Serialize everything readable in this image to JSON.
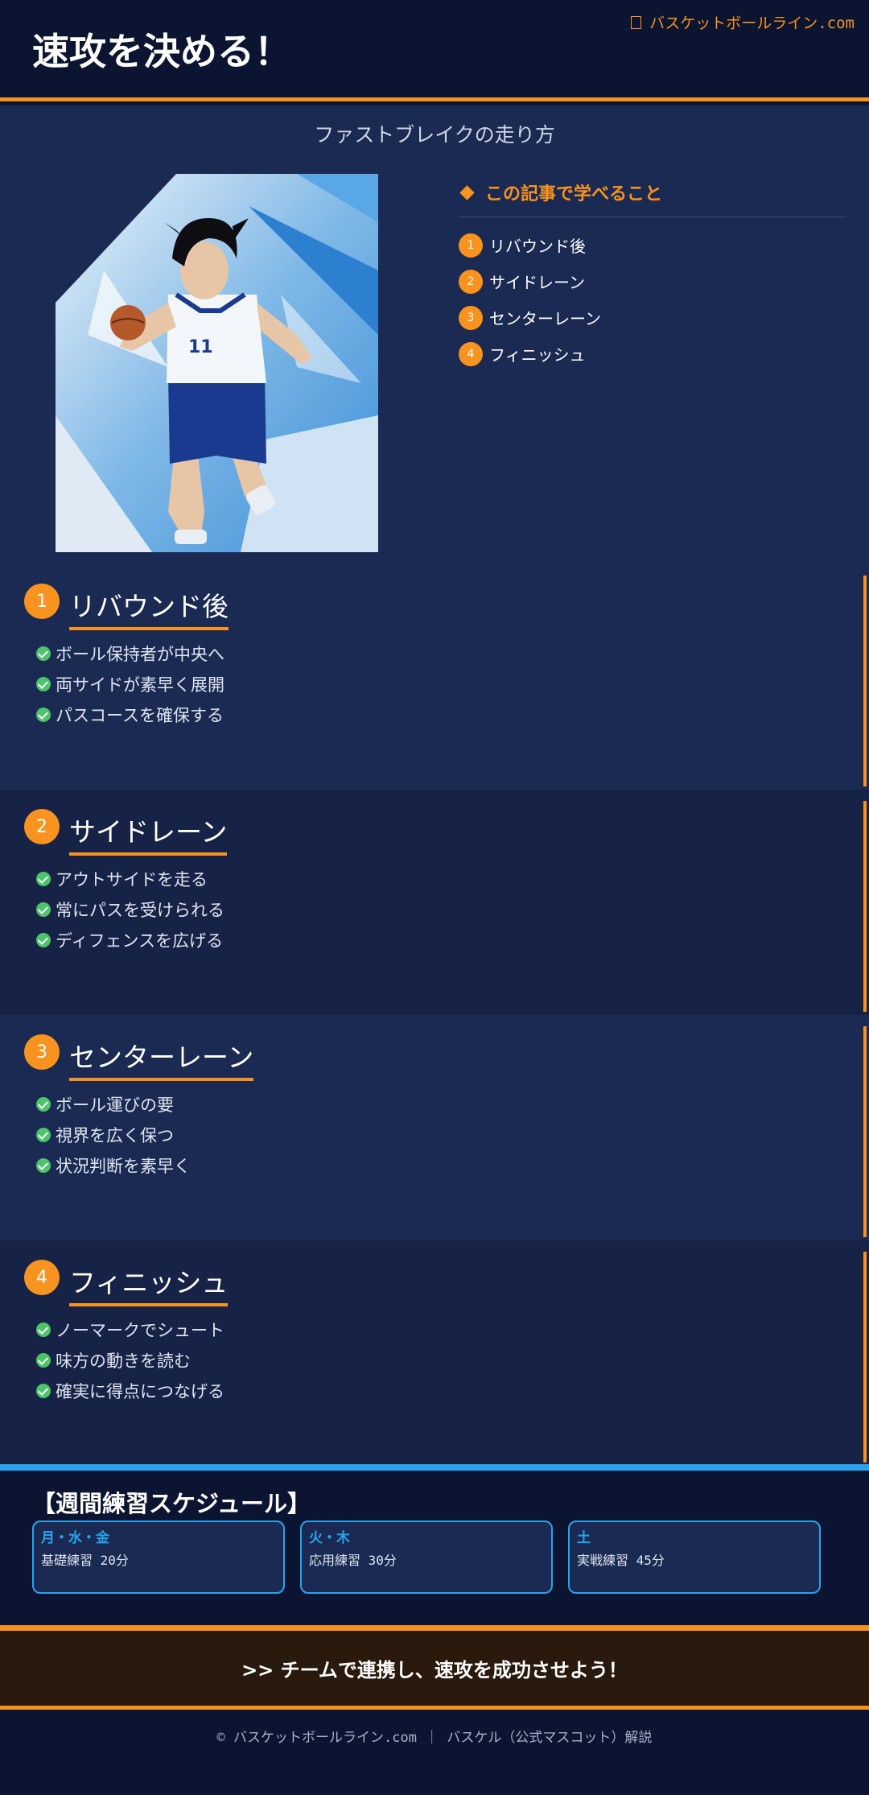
{
  "header": {
    "title": "速攻を決める！",
    "site": "バスケットボールライン.com"
  },
  "subtitle": "ファストブレイクの走り方",
  "toc": {
    "heading": "この記事で学べること",
    "items": [
      {
        "num": "1",
        "label": "リバウンド後"
      },
      {
        "num": "2",
        "label": "サイドレーン"
      },
      {
        "num": "3",
        "label": "センターレーン"
      },
      {
        "num": "4",
        "label": "フィニッシュ"
      }
    ]
  },
  "sections": [
    {
      "num": "1",
      "title": "リバウンド後",
      "bullets": [
        "ボール保持者が中央へ",
        "両サイドが素早く展開",
        "パスコースを確保する"
      ],
      "bg": "#1b2a52"
    },
    {
      "num": "2",
      "title": "サイドレーン",
      "bullets": [
        "アウトサイドを走る",
        "常にパスを受けられる",
        "ディフェンスを広げる"
      ],
      "bg": "#172346"
    },
    {
      "num": "3",
      "title": "センターレーン",
      "bullets": [
        "ボール運びの要",
        "視界を広く保つ",
        "状況判断を素早く"
      ],
      "bg": "#1b2a52"
    },
    {
      "num": "4",
      "title": "フィニッシュ",
      "bullets": [
        "ノーマークでシュート",
        "味方の動きを読む",
        "確実に得点につなげる"
      ],
      "bg": "#172346"
    }
  ],
  "schedule": {
    "title": "【週間練習スケジュール】",
    "cards": [
      {
        "day": "月・水・金",
        "desc": "基礎練習 20分"
      },
      {
        "day": "火・木",
        "desc": "応用練習 30分"
      },
      {
        "day": "土",
        "desc": "実戦練習 45分"
      }
    ]
  },
  "cta": ">> チームで連携し、速攻を成功させよう！",
  "footer": "© バスケットボールライン.com ｜ バスケル（公式マスコット）解説",
  "colors": {
    "accent": "#f7931e",
    "blue": "#29a3f0",
    "navy": "#0b1430",
    "panel": "#1b2a52",
    "check": "#4cc46a"
  }
}
